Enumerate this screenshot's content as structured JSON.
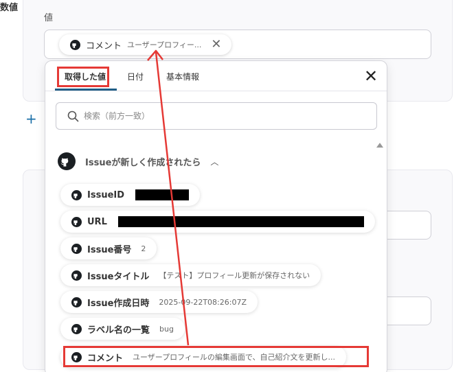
{
  "field": {
    "label": "値"
  },
  "value_chip": {
    "title": "コメント",
    "subtitle": "ユーザープロフィー...",
    "close_glyph": "✕"
  },
  "add_icon": "+",
  "numeric_label": "数値",
  "popup": {
    "tabs": [
      {
        "label": "取得した値",
        "active": true
      },
      {
        "label": "日付"
      },
      {
        "label": "基本情報"
      }
    ],
    "close_glyph": "✕",
    "search": {
      "placeholder": "検索（前方一致）",
      "value": ""
    },
    "section": {
      "title": "Issueが新しく作成されたら",
      "chevron": "︿"
    },
    "items": [
      {
        "name": "IssueID",
        "value": ""
      },
      {
        "name": "URL",
        "value": ""
      },
      {
        "name": "Issue番号",
        "value": "2"
      },
      {
        "name": "Issueタイトル",
        "value": "【テスト】プロフィール更新が保存されない"
      },
      {
        "name": "Issue作成日時",
        "value": "2025-09-22T08:26:07Z"
      },
      {
        "name": "ラベル名の一覧",
        "value": "bug"
      },
      {
        "name": "コメント",
        "value": "ユーザープロフィールの編集画面で、自己紹介文を更新し..."
      }
    ]
  },
  "colors": {
    "highlight": "#e53935",
    "accent": "#1f5d86",
    "add": "#1a6fa8"
  },
  "icons": {
    "integration": "github-icon",
    "search": "search-icon"
  }
}
